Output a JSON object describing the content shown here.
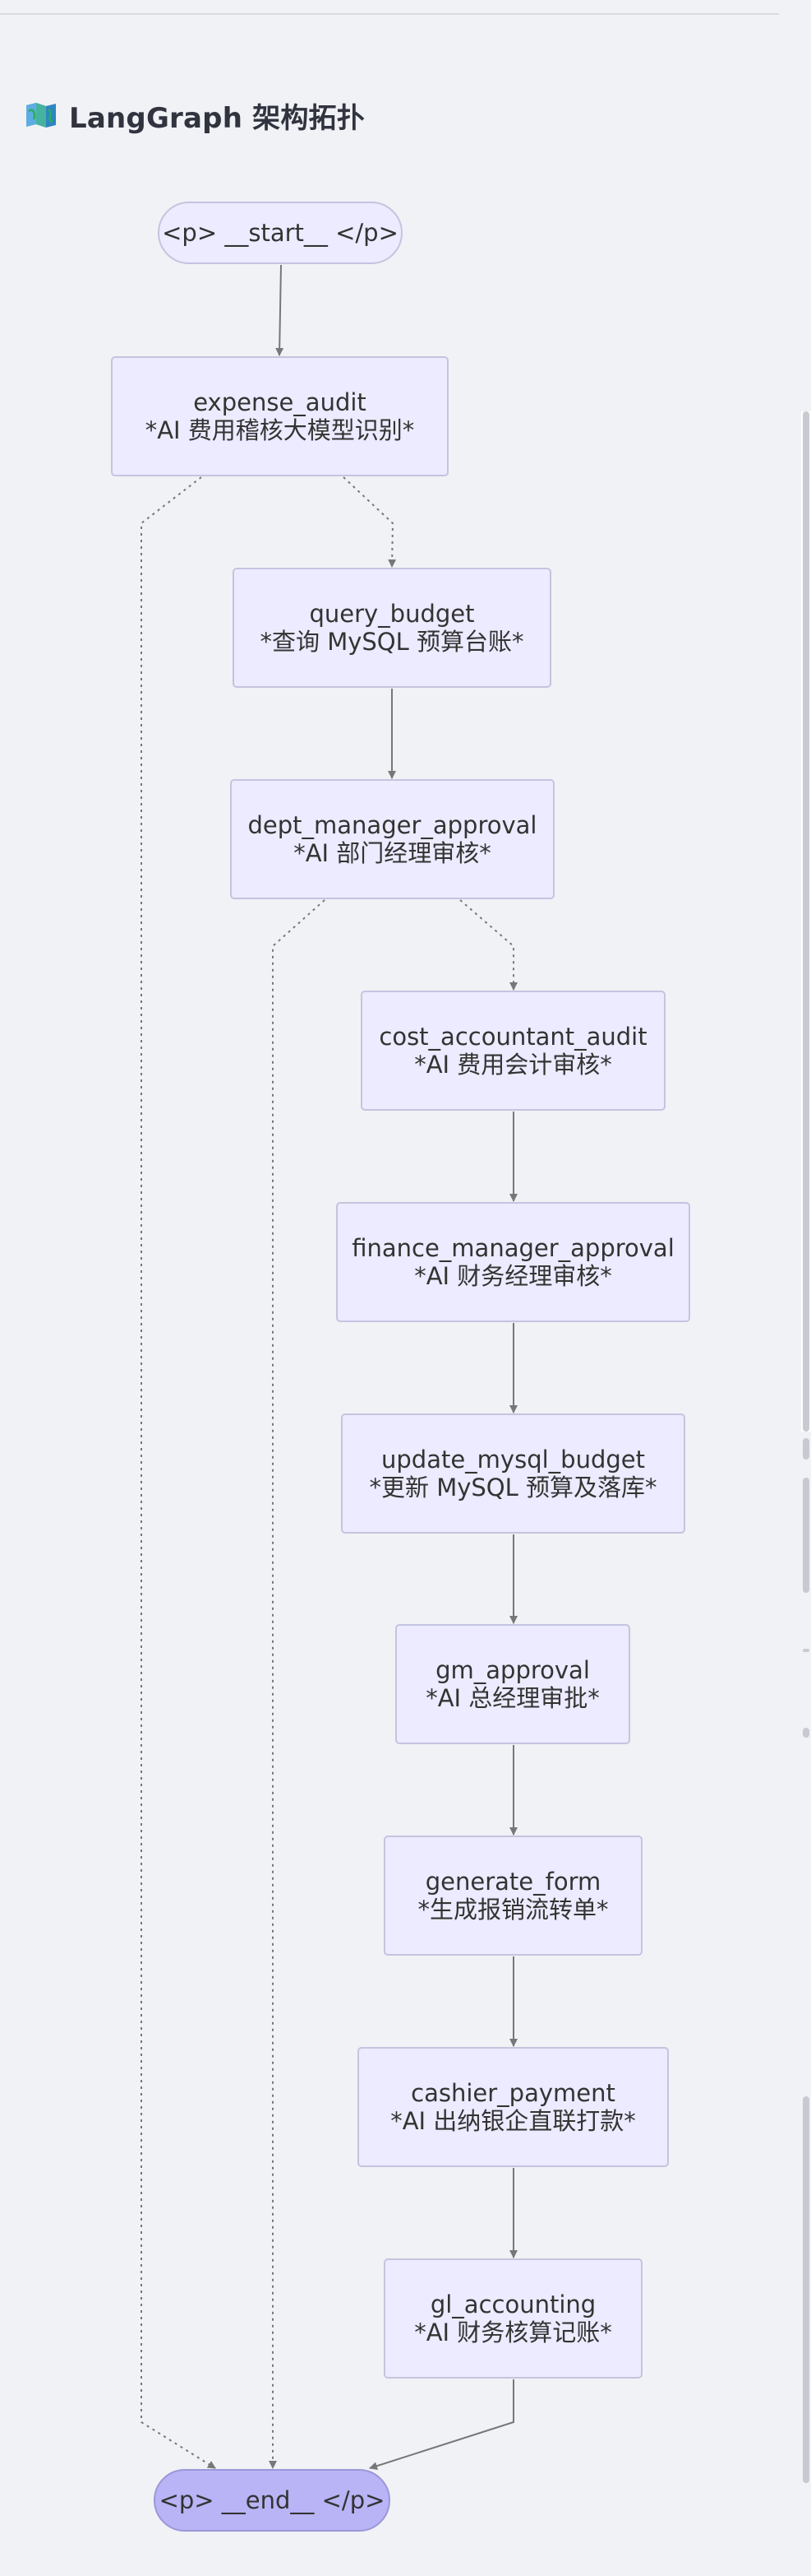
{
  "header": {
    "icon": "map-icon",
    "title": "LangGraph 架构拓扑"
  },
  "diagram": {
    "nodes": [
      {
        "id": "start",
        "lines": [
          "<p> __start__ </p>"
        ],
        "kind": "terminal"
      },
      {
        "id": "expense_audit",
        "lines": [
          "expense_audit",
          "*AI 费用稽核大模型识别*"
        ],
        "kind": "process"
      },
      {
        "id": "query_budget",
        "lines": [
          "query_budget",
          "*查询 MySQL 预算台账*"
        ],
        "kind": "process"
      },
      {
        "id": "dept_manager_approval",
        "lines": [
          "dept_manager_approval",
          "*AI 部门经理审核*"
        ],
        "kind": "process"
      },
      {
        "id": "cost_accountant_audit",
        "lines": [
          "cost_accountant_audit",
          "*AI 费用会计审核*"
        ],
        "kind": "process"
      },
      {
        "id": "finance_manager_approval",
        "lines": [
          "finance_manager_approval",
          "*AI 财务经理审核*"
        ],
        "kind": "process"
      },
      {
        "id": "update_mysql_budget",
        "lines": [
          "update_mysql_budget",
          "*更新 MySQL 预算及落库*"
        ],
        "kind": "process"
      },
      {
        "id": "gm_approval",
        "lines": [
          "gm_approval",
          "*AI 总经理审批*"
        ],
        "kind": "process"
      },
      {
        "id": "generate_form",
        "lines": [
          "generate_form",
          "*生成报销流转单*"
        ],
        "kind": "process"
      },
      {
        "id": "cashier_payment",
        "lines": [
          "cashier_payment",
          "*AI 出纳银企直联打款*"
        ],
        "kind": "process"
      },
      {
        "id": "gl_accounting",
        "lines": [
          "gl_accounting",
          "*AI 财务核算记账*"
        ],
        "kind": "process"
      },
      {
        "id": "end",
        "lines": [
          "<p> __end__ </p>"
        ],
        "kind": "end"
      }
    ],
    "edges": [
      {
        "from": "start",
        "to": "expense_audit",
        "style": "solid"
      },
      {
        "from": "expense_audit",
        "to": "query_budget",
        "style": "dotted"
      },
      {
        "from": "expense_audit",
        "to": "end",
        "style": "dotted"
      },
      {
        "from": "query_budget",
        "to": "dept_manager_approval",
        "style": "solid"
      },
      {
        "from": "dept_manager_approval",
        "to": "cost_accountant_audit",
        "style": "dotted"
      },
      {
        "from": "dept_manager_approval",
        "to": "end",
        "style": "dotted"
      },
      {
        "from": "cost_accountant_audit",
        "to": "finance_manager_approval",
        "style": "solid"
      },
      {
        "from": "finance_manager_approval",
        "to": "update_mysql_budget",
        "style": "solid"
      },
      {
        "from": "update_mysql_budget",
        "to": "gm_approval",
        "style": "solid"
      },
      {
        "from": "gm_approval",
        "to": "generate_form",
        "style": "solid"
      },
      {
        "from": "generate_form",
        "to": "cashier_payment",
        "style": "solid"
      },
      {
        "from": "cashier_payment",
        "to": "gl_accounting",
        "style": "solid"
      },
      {
        "from": "gl_accounting",
        "to": "end",
        "style": "solid"
      }
    ]
  }
}
